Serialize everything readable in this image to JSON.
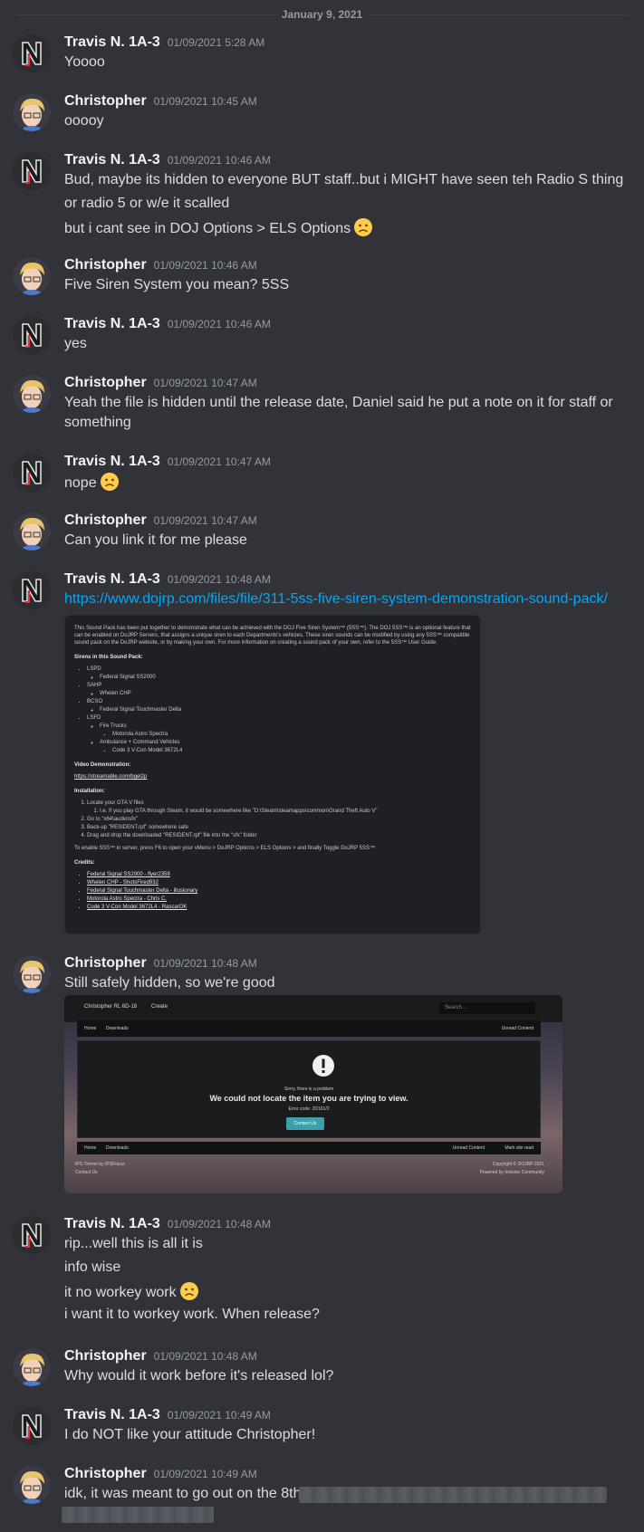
{
  "date_divider": "January 9, 2021",
  "messages": [
    {
      "author": "Travis N. 1A-3",
      "time": "01/09/2021 5:28 AM",
      "lines": [
        "Yoooo"
      ]
    },
    {
      "author": "Christopher",
      "time": "01/09/2021 10:45 AM",
      "lines": [
        "ooooy"
      ]
    },
    {
      "author": "Travis N. 1A-3",
      "time": "01/09/2021 10:46 AM",
      "lines": [
        "Bud, maybe its hidden to everyone BUT staff..but i MIGHT have seen teh Radio S thing",
        "or radio 5 or w/e it scalled",
        "but i cant see in DOJ Options > ELS Options"
      ]
    },
    {
      "author": "Christopher",
      "time": "01/09/2021 10:46 AM",
      "lines": [
        "Five Siren System you mean? 5SS"
      ]
    },
    {
      "author": "Travis N. 1A-3",
      "time": "01/09/2021 10:46 AM",
      "lines": [
        "yes"
      ]
    },
    {
      "author": "Christopher",
      "time": "01/09/2021 10:47 AM",
      "lines": [
        "Yeah the file is hidden until the release date, Daniel said he put a note on it for staff or",
        "something"
      ]
    },
    {
      "author": "Travis N. 1A-3",
      "time": "01/09/2021 10:47 AM",
      "lines": [
        "nope"
      ]
    },
    {
      "author": "Christopher",
      "time": "01/09/2021 10:47 AM",
      "lines": [
        "Can you link it for me please"
      ]
    },
    {
      "author": "Travis N. 1A-3",
      "time": "01/09/2021 10:48 AM",
      "link": "https://www.dojrp.com/files/file/311-5ss-five-siren-system-demonstration-sound-pack/"
    },
    {
      "author": "Christopher",
      "time": "01/09/2021 10:48 AM",
      "lines": [
        "Still safely hidden, so we're good"
      ]
    },
    {
      "author": "Travis N. 1A-3",
      "time": "01/09/2021 10:48 AM",
      "lines": [
        "rip...well this is all it is",
        "info wise",
        "it no workey work",
        "i want it to workey work. When release?"
      ]
    },
    {
      "author": "Christopher",
      "time": "01/09/2021 10:48 AM",
      "lines": [
        "Why would it work before it's released lol?"
      ]
    },
    {
      "author": "Travis N. 1A-3",
      "time": "01/09/2021 10:49 AM",
      "lines": [
        "I do NOT like your attitude Christopher!"
      ]
    },
    {
      "author": "Christopher",
      "time": "01/09/2021 10:49 AM",
      "lines": [
        "idk, it was meant to go out on the 8th"
      ]
    }
  ],
  "embed_text": {
    "intro": "This Sound Pack has been put together to demonstrate what can be achieved with the DOJ Five Siren System™ (5SS™). The DOJ 5SS™ is an optional feature that can be enabled on DoJRP Servers, that assigns a unique siren to each Departments's vehicles. These siren sounds can be modified by using any 5SS™ compatible sound pack on the DoJRP website, or by making your own. For more information on creating a sound pack of your own, refer to the 5SS™ User Guide.",
    "sirens_heading": "Sirens in this Sound Pack:",
    "sirens": [
      "LSPD",
      "Federal Signal SS2000",
      "SAHP",
      "Whelen CHP",
      "BCSO",
      "Federal Signal Touchmaster Delta",
      "LSFD",
      "Fire Trucks",
      "Motorola Astro Spectra",
      "Ambulance + Command Vehicles",
      "Code 3 V-Con Model 3672L4"
    ],
    "video_heading": "Video Demonstration:",
    "video_link": "https://streamable.com/bgel2p",
    "install_heading": "Installation:",
    "install_steps": [
      "Locate your GTA V files",
      "I.e. If you play GTA through Steam, it would be somewhere like \"D:\\Steam\\steamapps\\common\\Grand Theft Auto V\"",
      "Go to \"x64\\audio\\sfx\"",
      "Back-up \"RESIDENT.rpf\" somewhere safe",
      "Drag and drop the downloaded \"RESIDENT.rpf\" file into the \"sfx\" folder"
    ],
    "enable_note": "To enable 5SS™ in server, press F6 to open your vMenu > DoJRP Options > ELS Options > and finally Toggle DoJRP 5SS™",
    "credits_heading": "Credits:",
    "credits": [
      "Federal Signal SS2000 - flyer2359",
      "Whelen CHP - ShotsFired932",
      "Federal Signal Touchmaster Delta - illusionary",
      "Motorola Astro Spectra - Chris C.",
      "Code 3 V-Con Model 3672L4 - RascarOK"
    ]
  },
  "screenshot_embed": {
    "user": "Christopher RL 6D-18",
    "create": "Create",
    "search": "Search...",
    "home": "Home",
    "downloads": "Downloads",
    "unread": "Unread Content",
    "mark_read": "Mark site read",
    "sorry": "Sorry, there is a problem",
    "error": "We could not locate the item you are trying to view.",
    "error_code": "Error code: 2D161/2",
    "contact_btn": "Contact Us",
    "theme": "IPS Theme by IPSFocus",
    "contact": "Contact Us",
    "copyright": "Copyright © DOJRP 2021",
    "powered": "Powered by Invision Community"
  },
  "colors": {
    "background": "#313338",
    "link": "#00a8fc",
    "author": "#f2f3f5"
  }
}
